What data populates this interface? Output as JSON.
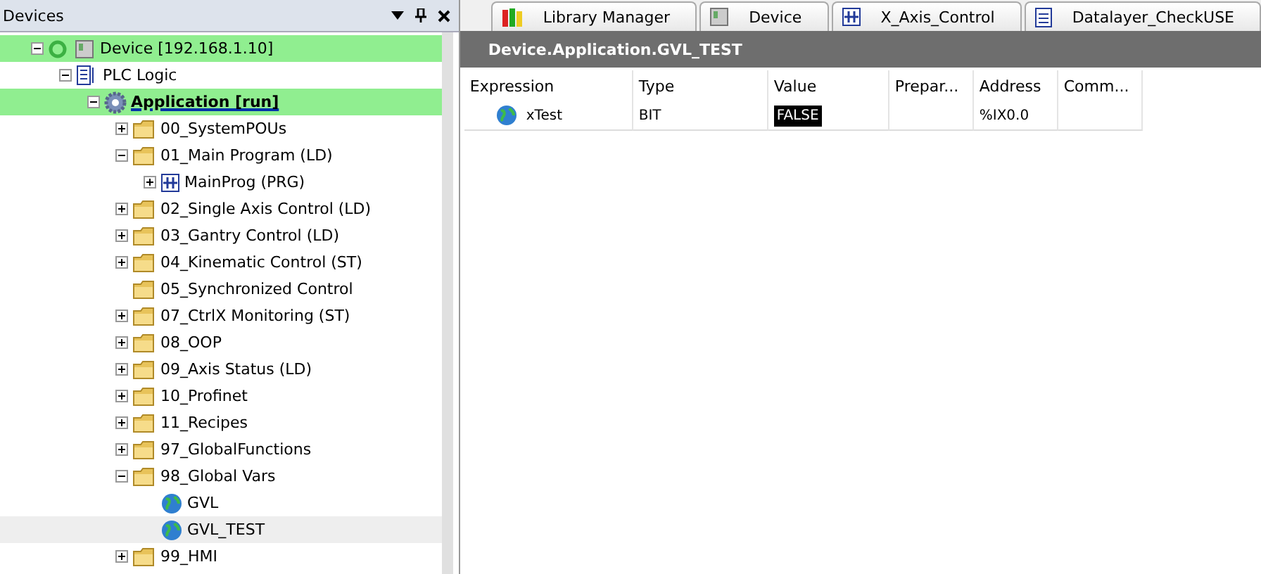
{
  "devices_panel": {
    "title": "Devices",
    "tree": [
      {
        "kind": "device",
        "label": "Device  [192.168.1.10]",
        "highlighted": true,
        "expanded": true,
        "children": [
          {
            "kind": "plc",
            "label": "PLC Logic",
            "expanded": true,
            "children": [
              {
                "kind": "app",
                "label": "Application [run]",
                "highlighted": true,
                "expanded": true,
                "children": [
                  {
                    "kind": "folder",
                    "label": "00_SystemPOUs",
                    "expanded": false
                  },
                  {
                    "kind": "folder",
                    "label": "01_Main Program (LD)",
                    "expanded": true,
                    "children": [
                      {
                        "kind": "prg",
                        "label": "MainProg (PRG)",
                        "expanded": false
                      }
                    ]
                  },
                  {
                    "kind": "folder",
                    "label": "02_Single Axis Control (LD)",
                    "expanded": false
                  },
                  {
                    "kind": "folder",
                    "label": "03_Gantry Control (LD)",
                    "expanded": false
                  },
                  {
                    "kind": "folder",
                    "label": "04_Kinematic Control (ST)",
                    "expanded": false
                  },
                  {
                    "kind": "folder",
                    "label": "05_Synchronized Control"
                  },
                  {
                    "kind": "folder",
                    "label": "07_CtrlX Monitoring (ST)",
                    "expanded": false
                  },
                  {
                    "kind": "folder",
                    "label": "08_OOP",
                    "expanded": false
                  },
                  {
                    "kind": "folder",
                    "label": "09_Axis Status (LD)",
                    "expanded": false
                  },
                  {
                    "kind": "folder",
                    "label": "10_Profinet",
                    "expanded": false
                  },
                  {
                    "kind": "folder",
                    "label": "11_Recipes",
                    "expanded": false
                  },
                  {
                    "kind": "folder",
                    "label": "97_GlobalFunctions",
                    "expanded": false
                  },
                  {
                    "kind": "folder",
                    "label": "98_Global Vars",
                    "expanded": true,
                    "children": [
                      {
                        "kind": "gvl",
                        "label": "GVL",
                        "selected": false
                      },
                      {
                        "kind": "gvl",
                        "label": "GVL_TEST",
                        "selected": true
                      }
                    ]
                  },
                  {
                    "kind": "folder",
                    "label": "99_HMI",
                    "expanded": false
                  }
                ]
              }
            ]
          }
        ]
      }
    ]
  },
  "tabs": [
    {
      "kind": "library",
      "label": "Library Manager"
    },
    {
      "kind": "device",
      "label": "Device"
    },
    {
      "kind": "prg",
      "label": "X_Axis_Control"
    },
    {
      "kind": "doc",
      "label": "Datalayer_CheckUSE"
    }
  ],
  "editor": {
    "title": "Device.Application.GVL_TEST",
    "columns": [
      "Expression",
      "Type",
      "Value",
      "Prepar...",
      "Address",
      "Comm..."
    ],
    "rows": [
      {
        "expression": "xTest",
        "type": "BIT",
        "value": "FALSE",
        "address": "%IX0.0"
      }
    ]
  }
}
